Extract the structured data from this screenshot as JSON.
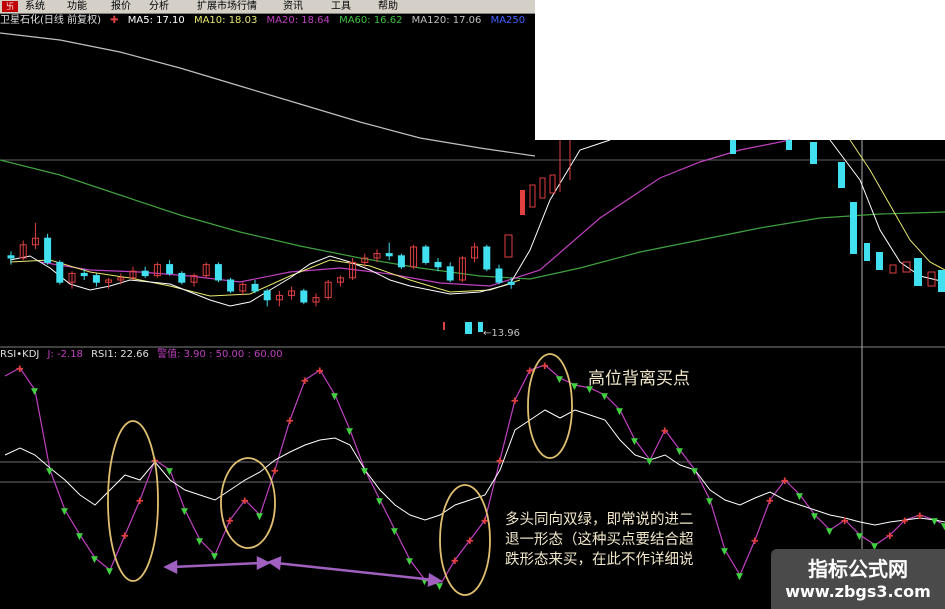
{
  "menu": {
    "items": [
      "系统",
      "功能",
      "报价",
      "分析",
      "扩展市场行情",
      "资讯",
      "工具",
      "帮助"
    ]
  },
  "price_panel": {
    "title": "卫星石化(日线 前复权)",
    "ma5": "MA5: 17.10",
    "ma10": "MA10: 18.03",
    "ma20": "MA20: 18.64",
    "ma60": "MA60: 16.62",
    "ma120": "MA120: 17.06",
    "ma250": "MA250",
    "low_label": "←13.96"
  },
  "indicator_panel": {
    "title": "RSI•KDJ",
    "j_value": "J: -2.18",
    "rsi1": "RSI1: 22.66",
    "warning": "警值: 3.90 : 50.00 : 60.00"
  },
  "annotations": {
    "top": "高位背离买点",
    "body": "多头同向双绿，即常说的进二退一形态（这种买点要结合超跌形态来买，在此不作详细说"
  },
  "watermark": {
    "title": "指标公式网",
    "url": "www.zbgs3.com"
  },
  "colors": {
    "up": "#e04040",
    "down": "#40e0f0",
    "ma5": "#ffffff",
    "ma10": "#e8e870",
    "ma20": "#c040c0",
    "ma60": "#40c040",
    "ma120": "#c0c0c0",
    "rsi": "#ffffff",
    "kdj": "#c040c0",
    "ellipse": "#e0c070",
    "arrow": "#a060c0"
  },
  "chart_data": {
    "type": "line",
    "title": "卫星石化(日线 前复权)",
    "candles": [
      [
        18.9,
        19.1,
        18.5,
        18.8
      ],
      [
        18.8,
        19.6,
        18.7,
        19.4
      ],
      [
        19.4,
        20.4,
        19.2,
        19.7
      ],
      [
        19.7,
        19.9,
        18.5,
        18.6
      ],
      [
        18.6,
        18.7,
        17.6,
        17.7
      ],
      [
        17.7,
        18.2,
        17.4,
        18.1
      ],
      [
        18.1,
        18.3,
        17.8,
        18.0
      ],
      [
        18.0,
        18.1,
        17.5,
        17.7
      ],
      [
        17.7,
        17.9,
        17.4,
        17.8
      ],
      [
        17.8,
        18.1,
        17.6,
        17.9
      ],
      [
        17.9,
        18.4,
        17.8,
        18.2
      ],
      [
        18.2,
        18.4,
        17.9,
        18.0
      ],
      [
        18.0,
        18.6,
        17.9,
        18.5
      ],
      [
        18.5,
        18.7,
        18.0,
        18.1
      ],
      [
        18.1,
        18.2,
        17.6,
        17.7
      ],
      [
        17.7,
        18.1,
        17.5,
        18.0
      ],
      [
        18.0,
        18.6,
        17.9,
        18.5
      ],
      [
        18.5,
        18.6,
        17.7,
        17.8
      ],
      [
        17.8,
        17.9,
        17.2,
        17.3
      ],
      [
        17.3,
        17.7,
        17.1,
        17.6
      ],
      [
        17.6,
        17.8,
        17.2,
        17.3
      ],
      [
        17.3,
        17.4,
        16.6,
        16.9
      ],
      [
        16.9,
        17.3,
        16.6,
        17.1
      ],
      [
        17.1,
        17.5,
        16.9,
        17.3
      ],
      [
        17.3,
        17.4,
        16.7,
        16.8
      ],
      [
        16.8,
        17.2,
        16.6,
        17.0
      ],
      [
        17.0,
        17.8,
        16.9,
        17.7
      ],
      [
        17.7,
        18.0,
        17.5,
        17.9
      ],
      [
        17.9,
        18.8,
        17.8,
        18.6
      ],
      [
        18.6,
        19.0,
        18.4,
        18.8
      ],
      [
        18.8,
        19.2,
        18.6,
        19.0
      ],
      [
        19.0,
        19.5,
        18.7,
        18.9
      ],
      [
        18.9,
        19.0,
        18.3,
        18.4
      ],
      [
        18.4,
        19.4,
        18.3,
        19.3
      ],
      [
        19.3,
        19.4,
        18.5,
        18.6
      ],
      [
        18.6,
        18.8,
        18.2,
        18.4
      ],
      [
        18.4,
        18.6,
        17.7,
        17.8
      ],
      [
        17.8,
        18.9,
        17.7,
        18.8
      ],
      [
        18.8,
        19.5,
        18.6,
        19.3
      ],
      [
        19.3,
        19.4,
        18.2,
        18.3
      ],
      [
        18.3,
        18.5,
        17.6,
        17.7
      ],
      [
        17.7,
        17.9,
        17.4,
        17.6
      ]
    ],
    "low_marker": 13.96,
    "ma120_line": [
      26.0,
      25.4,
      24.8,
      24.2,
      23.6,
      23.0,
      22.5,
      22.0,
      21.5,
      21.0,
      20.5,
      20.0
    ]
  }
}
